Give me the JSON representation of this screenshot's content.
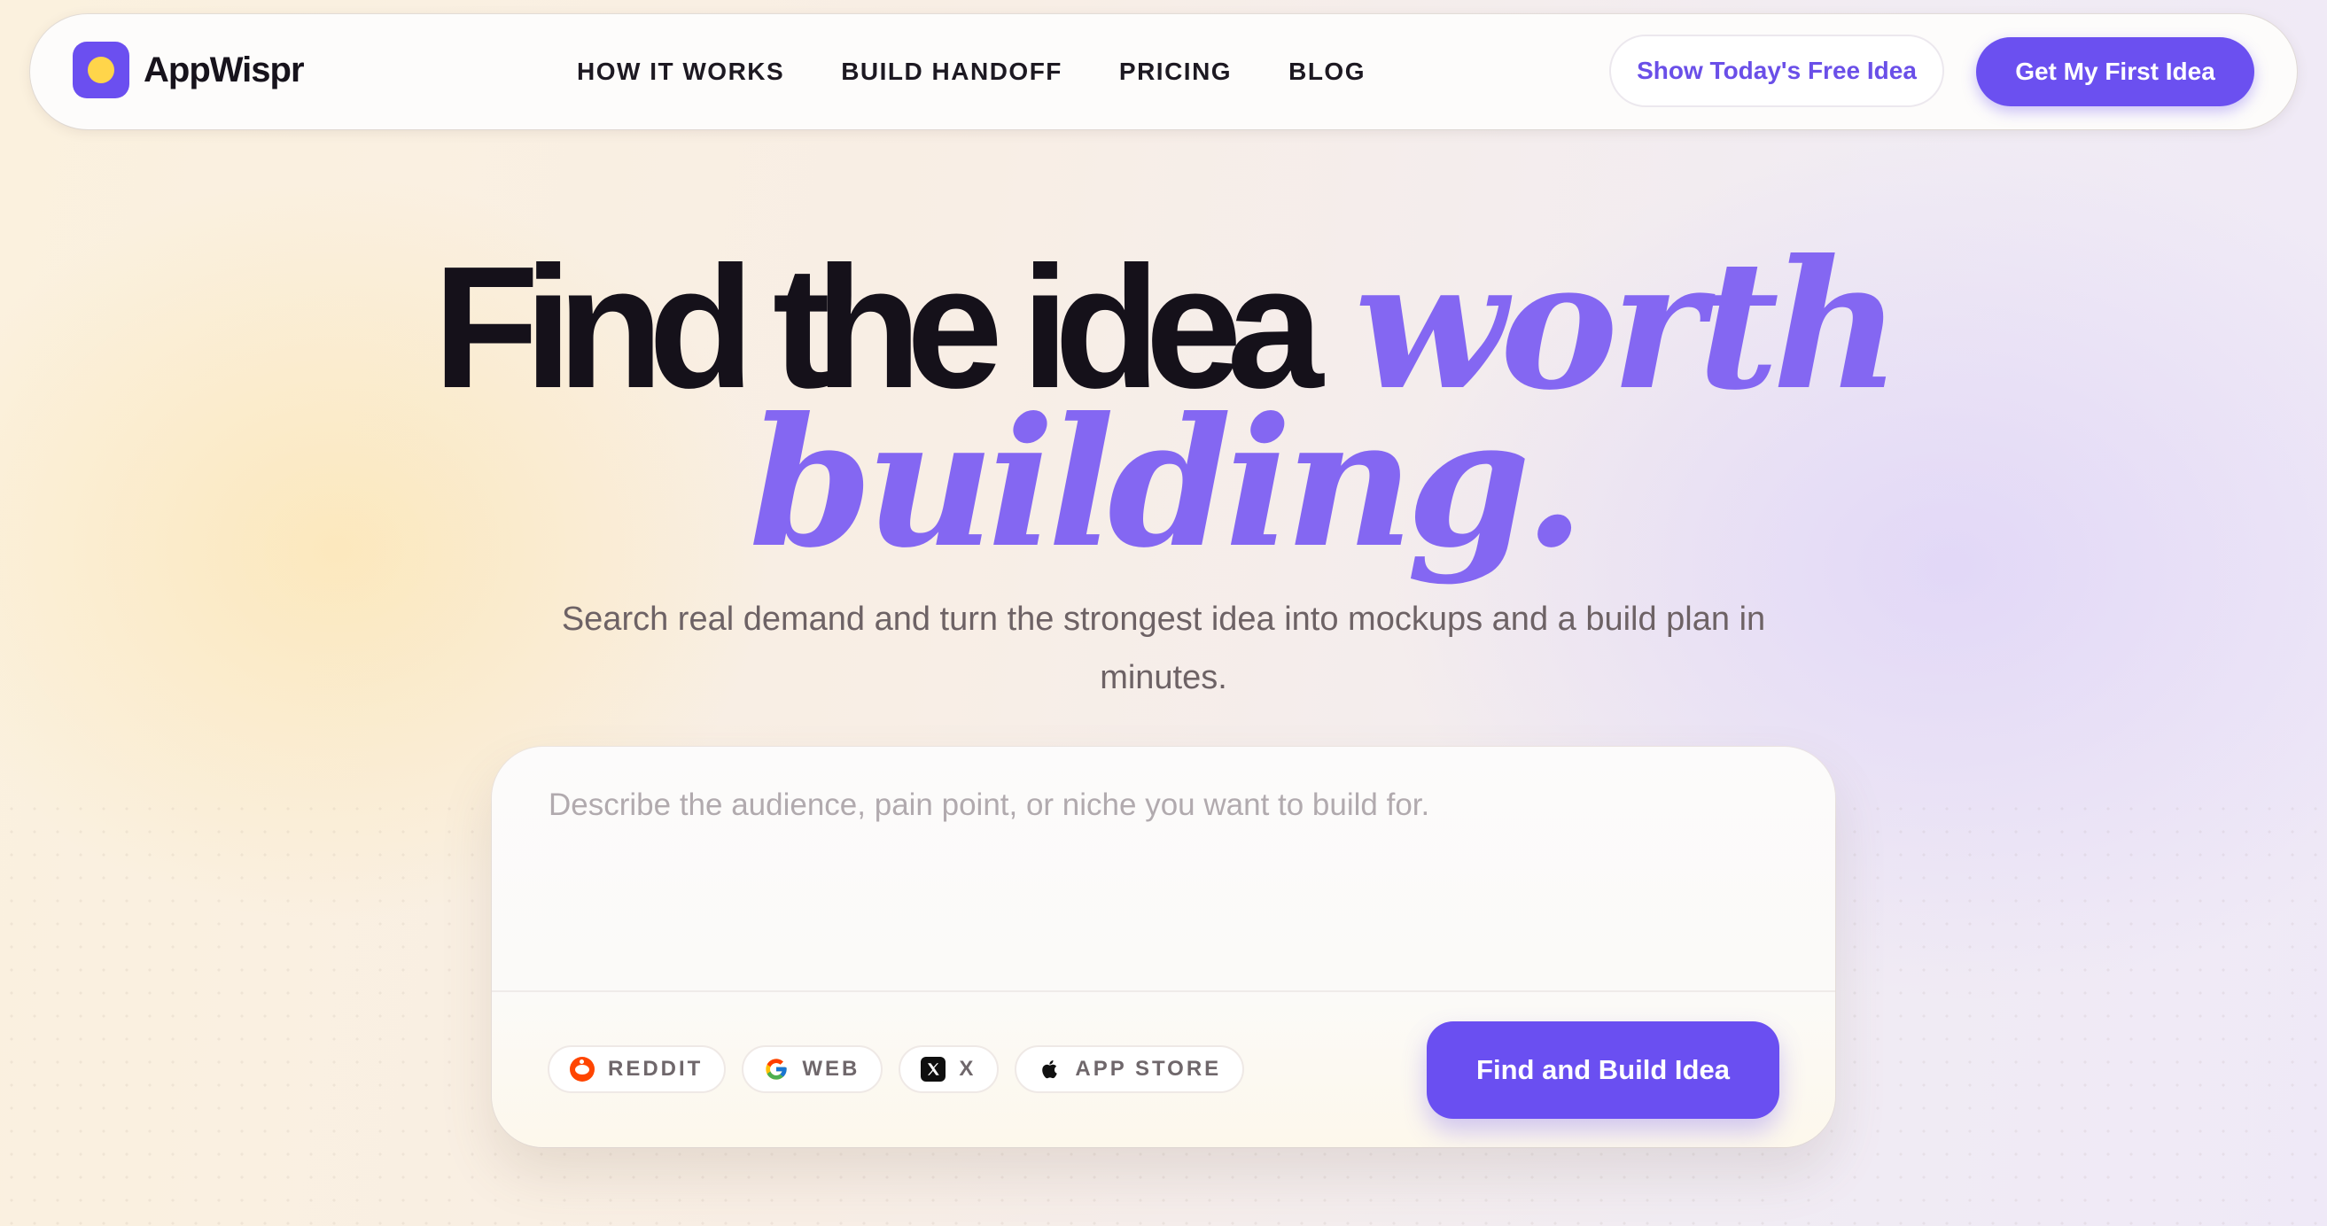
{
  "brand": {
    "name": "AppWispr",
    "accent_color": "#6b4ff0",
    "dot_color": "#ffd54a"
  },
  "nav": {
    "links": [
      "HOW IT WORKS",
      "BUILD HANDOFF",
      "PRICING",
      "BLOG"
    ],
    "secondary_cta": "Show Today's Free Idea",
    "primary_cta": "Get My First Idea"
  },
  "hero": {
    "headline_plain": "Find the idea",
    "headline_accent_1": "worth",
    "headline_accent_2": "building.",
    "subtitle": "Search real demand and turn the strongest idea into mockups and a build plan in minutes."
  },
  "search": {
    "placeholder": "Describe the audience, pain point, or niche you want to build for.",
    "value": "",
    "sources": [
      {
        "label": "REDDIT",
        "icon": "reddit-icon"
      },
      {
        "label": "WEB",
        "icon": "google-icon"
      },
      {
        "label": "X",
        "icon": "x-icon"
      },
      {
        "label": "APP STORE",
        "icon": "apple-icon"
      }
    ],
    "submit_label": "Find and Build Idea"
  },
  "colors": {
    "accent": "#8467f2",
    "button": "#6a4ff1",
    "heading": "#15111a"
  }
}
